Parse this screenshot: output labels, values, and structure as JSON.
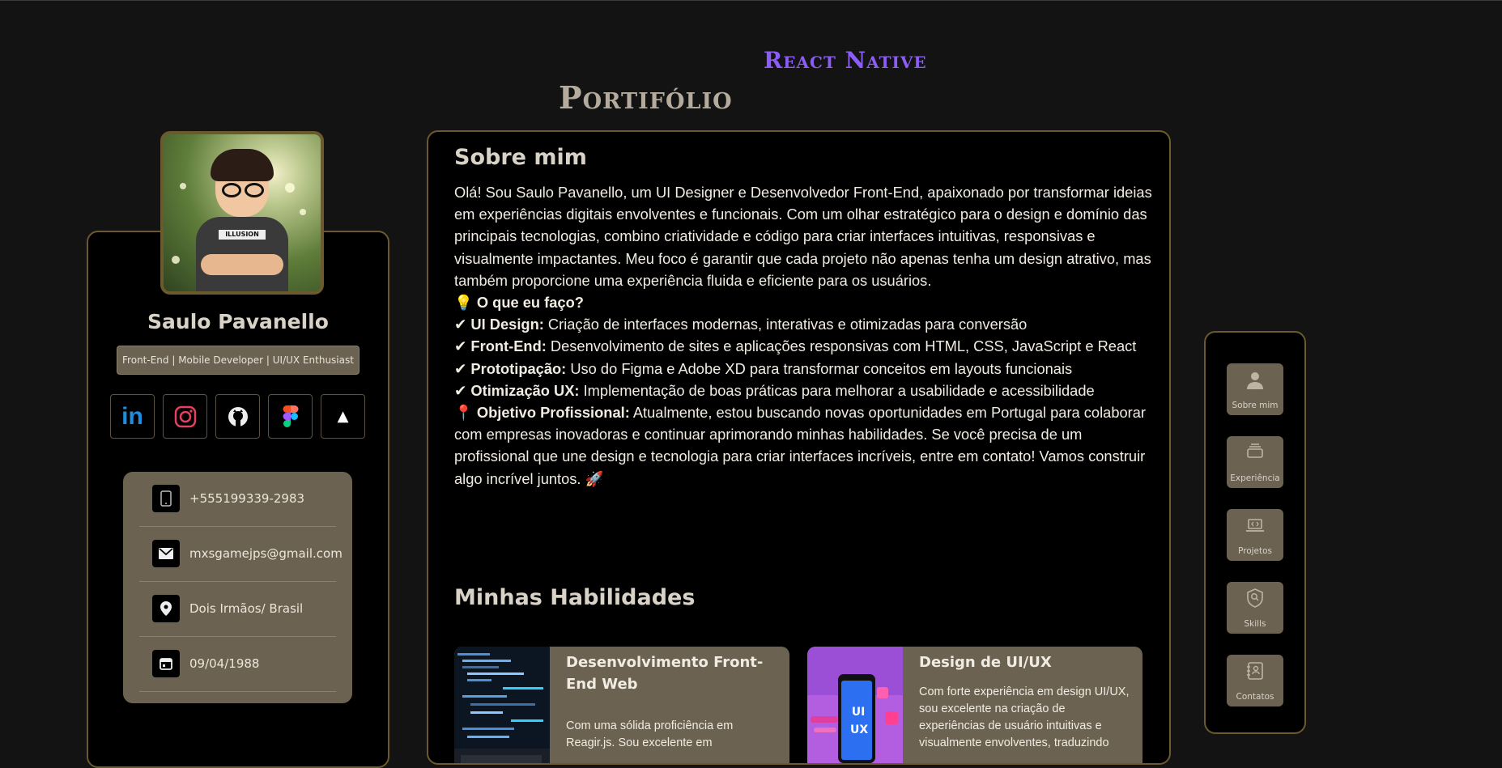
{
  "header": {
    "subtitle": "React Native",
    "title": "Portifólio"
  },
  "profile": {
    "name": "Saulo Pavanello",
    "role": "Front-End | Mobile Developer | UI/UX Enthusiast",
    "avatar_shirt_text": "ILLUSION",
    "socials": [
      {
        "name": "linkedin",
        "label": "in"
      },
      {
        "name": "instagram",
        "label": ""
      },
      {
        "name": "github",
        "label": ""
      },
      {
        "name": "figma",
        "label": ""
      },
      {
        "name": "scroll-top",
        "label": "▲"
      }
    ],
    "contacts": {
      "phone": "+555199339-2983",
      "email": "mxsgamejps@gmail.com",
      "location": "Dois Irmãos/ Brasil",
      "birthdate": "09/04/1988"
    }
  },
  "about": {
    "title": "Sobre mim",
    "intro": "Olá! Sou Saulo Pavanello, um UI Designer e Desenvolvedor Front-End, apaixonado por transformar ideias em experiências digitais envolventes e funcionais. Com um olhar estratégico para o design e domínio das principais tecnologias, combino criatividade e código para criar interfaces intuitivas, responsivas e visualmente impactantes. Meu foco é garantir que cada projeto não apenas tenha um design atrativo, mas também proporcione uma experiência fluida e eficiente para os usuários.",
    "what_i_do_icon": "💡",
    "what_i_do_title": "O que eu faço?",
    "items": [
      {
        "check": "✔",
        "title": "UI Design:",
        "text": " Criação de interfaces modernas, interativas e otimizadas para conversão"
      },
      {
        "check": "✔",
        "title": "Front-End:",
        "text": " Desenvolvimento de sites e aplicações responsivas com HTML, CSS, JavaScript e React"
      },
      {
        "check": "✔",
        "title": "Prototipação:",
        "text": " Uso do Figma e Adobe XD para transformar conceitos em layouts funcionais"
      },
      {
        "check": "✔",
        "title": "Otimização UX:",
        "text": " Implementação de boas práticas para melhorar a usabilidade e acessibilidade"
      }
    ],
    "goal_icon": "📍",
    "goal_title": "Objetivo Profissional:",
    "goal_text": " Atualmente, estou buscando novas oportunidades em Portugal para colaborar com empresas inovadoras e continuar aprimorando minhas habilidades. Se você precisa de um profissional que une design e tecnologia para criar interfaces incríveis, entre em contato! Vamos construir algo incrível juntos. 🚀"
  },
  "skills": {
    "title": "Minhas Habilidades",
    "cards": [
      {
        "title": "Desenvolvimento Front-End Web",
        "desc": "Com uma sólida proficiência em Reagir.js. Sou excelente em"
      },
      {
        "title": "Design de UI/UX",
        "desc": "Com forte experiência em design UI/UX, sou excelente na criação de experiências de usuário intuitivas e visualmente envolventes, traduzindo",
        "img_text": "UI UX"
      }
    ]
  },
  "nav": [
    {
      "label": "Sobre mim",
      "icon": "user-icon"
    },
    {
      "label": "Experiência",
      "icon": "layers-icon"
    },
    {
      "label": "Projetos",
      "icon": "laptop-code-icon"
    },
    {
      "label": "Skills",
      "icon": "badge-search-icon"
    },
    {
      "label": "Contatos",
      "icon": "contact-card-icon"
    }
  ],
  "colors": {
    "background": "#131313",
    "panel": "#000000",
    "border": "#6b5a2e",
    "card": "#6b6252",
    "accent": "#8b5cf6"
  }
}
